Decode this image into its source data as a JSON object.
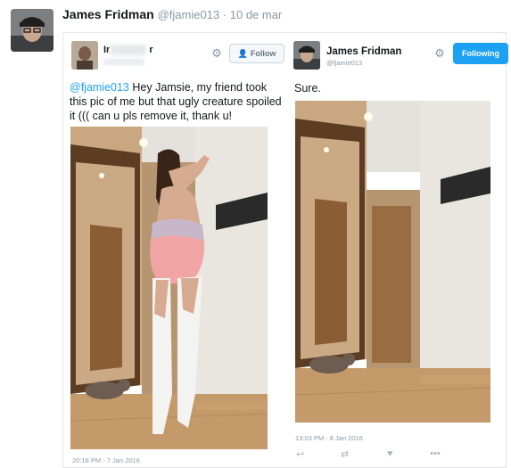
{
  "outer": {
    "name": "James Fridman",
    "handle": "@fjamie013",
    "separator": " · ",
    "date": "10 de mar"
  },
  "left_card": {
    "name_visible": "Ir",
    "name_visible_end": "r",
    "follow_label": "Follow",
    "mention": "@fjamie013",
    "text": " Hey Jamsie, my friend took this pic of me but that ugly creature spoiled it ((( can u pls remove it, thank u!",
    "timestamp": "20:18 PM - 7 Jan 2016"
  },
  "right_card": {
    "name": "James Fridman",
    "handle": "@fjamie013",
    "following_label": "Following",
    "text": "Sure.",
    "timestamp": "13:03 PM - 8 Jan 2016",
    "actions": [
      "reply-icon",
      "retweet-icon",
      "like-icon",
      "more-icon"
    ],
    "action_more": "•••"
  },
  "colors": {
    "accent": "#1da1f2",
    "muted": "#8899a6",
    "border": "#e1e8ed"
  }
}
